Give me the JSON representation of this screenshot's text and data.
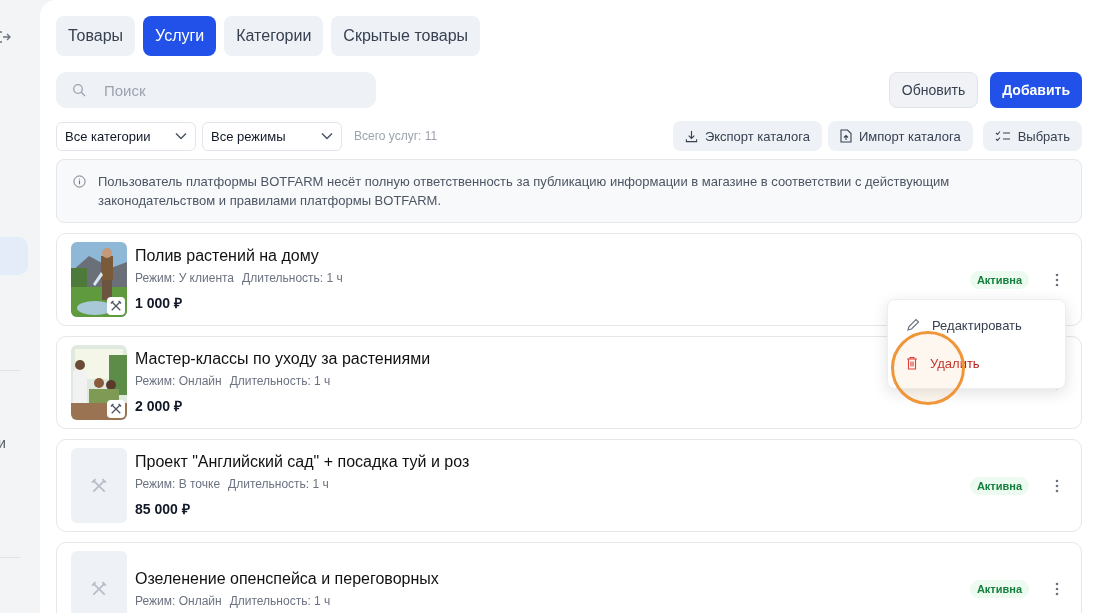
{
  "sidebar": {
    "items": [
      {
        "selected": true
      },
      {
        "label": "и",
        "selected": false
      }
    ]
  },
  "tabs": [
    {
      "label": "Товары",
      "selected": false
    },
    {
      "label": "Услуги",
      "selected": true
    },
    {
      "label": "Категории",
      "selected": false
    },
    {
      "label": "Скрытые товары",
      "selected": false
    }
  ],
  "search": {
    "placeholder": "Поиск"
  },
  "actions": {
    "refresh": "Обновить",
    "add": "Добавить"
  },
  "filters": [
    {
      "value": "Все категории"
    },
    {
      "value": "Все режимы"
    }
  ],
  "count": "Всего услуг: 11",
  "tools": [
    {
      "kind": "export",
      "label": "Экспорт каталога"
    },
    {
      "kind": "import",
      "label": "Импорт каталога"
    },
    {
      "kind": "select",
      "label": "Выбрать"
    }
  ],
  "notice": "Пользователь платформы BOTFARM несёт полную ответственность за публикацию информации в магазине в соответствии с действующим законодательством и правилами платформы BOTFARM.",
  "services": [
    {
      "kind": "picture",
      "title": "Полив растений на дому",
      "mode": "Режим: У клиента",
      "duration": "Длительность: 1 ч",
      "price": "1 000 ₽",
      "status": "Активна"
    },
    {
      "kind": "picture",
      "title": "Мастер-классы по уходу за растениями",
      "mode": "Режим: Онлайн",
      "duration": "Длительность: 1 ч",
      "price": "2 000 ₽"
    },
    {
      "kind": "placeholder",
      "title": "Проект \"Английский сад\" + посадка туй и роз",
      "mode": "Режим: В точке",
      "duration": "Длительность: 1 ч",
      "price": "85 000 ₽",
      "status": "Активна"
    },
    {
      "kind": "placeholder",
      "title": "Озеленение опенспейса и переговорных",
      "mode": "Режим: Онлайн",
      "duration": "Длительность: 1 ч",
      "status": "Активна"
    }
  ],
  "menu": {
    "items": [
      {
        "kind": "edit",
        "label": "Редактировать"
      },
      {
        "kind": "delete",
        "label": "Удалить"
      }
    ]
  }
}
